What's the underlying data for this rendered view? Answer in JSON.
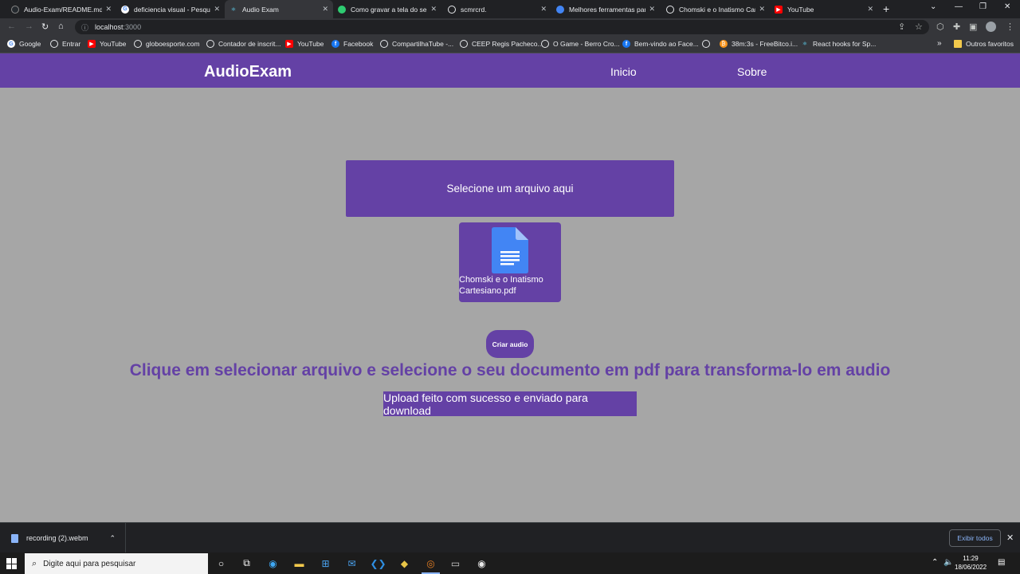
{
  "browser": {
    "tabs": [
      {
        "title": "Audio-Exam/README.md",
        "icon": "github-icon",
        "color": "#24292e"
      },
      {
        "title": "deficiencia visual - Pesquis",
        "icon": "google-icon",
        "color": "#ffffff"
      },
      {
        "title": "Audio Exam",
        "icon": "react-icon",
        "color": "#61dafb"
      },
      {
        "title": "Como gravar a tela do seu",
        "icon": "green-circle-icon",
        "color": "#2ecc71"
      },
      {
        "title": "scmrcrd.",
        "icon": "globe-icon",
        "color": "#e8eaed"
      },
      {
        "title": "Melhores ferramentas par",
        "icon": "blue-tool-icon",
        "color": "#4285f4"
      },
      {
        "title": "Chomski e o Inatismo Cart",
        "icon": "globe-icon",
        "color": "#e8eaed"
      },
      {
        "title": "YouTube",
        "icon": "youtube-icon",
        "color": "#ff0000"
      }
    ],
    "url": "localhost",
    "url_port": ":3000",
    "bookmarks": [
      {
        "label": "Google",
        "icon": "google-icon",
        "color": "#ffffff"
      },
      {
        "label": "Entrar",
        "icon": "globe-icon",
        "color": "#e8eaed"
      },
      {
        "label": "YouTube",
        "icon": "youtube-icon",
        "color": "#ff0000"
      },
      {
        "label": "globoesporte.com",
        "icon": "globe-icon",
        "color": "#e8eaed"
      },
      {
        "label": "Contador de inscrit...",
        "icon": "globe-icon",
        "color": "#e8eaed"
      },
      {
        "label": "YouTube",
        "icon": "youtube-icon",
        "color": "#ff0000"
      },
      {
        "label": "Facebook",
        "icon": "facebook-icon",
        "color": "#1877f2"
      },
      {
        "label": "CompartilhaTube -...",
        "icon": "globe-icon",
        "color": "#e8eaed"
      },
      {
        "label": "CEEP Regis Pacheco...",
        "icon": "globe-icon",
        "color": "#e8eaed"
      },
      {
        "label": "O Game - Berro Cro...",
        "icon": "globe-icon",
        "color": "#e8eaed"
      },
      {
        "label": "Bem-vindo ao Face...",
        "icon": "facebook-icon",
        "color": "#1877f2"
      },
      {
        "label": "",
        "icon": "globe-icon",
        "color": "#e8eaed"
      },
      {
        "label": "38m:3s - FreeBitco.i...",
        "icon": "bitcoin-icon",
        "color": "#f7931a"
      },
      {
        "label": "React hooks for Sp...",
        "icon": "react-icon",
        "color": "#61dafb"
      }
    ],
    "other_bookmarks": "Outros favoritos"
  },
  "app": {
    "brand": "AudioExam",
    "nav": [
      "Inicio",
      "Sobre"
    ],
    "select_file_label": "Selecione um arquivo aqui",
    "file_name": "Chomski e o Inatismo Cartesiano.pdf",
    "create_audio_label": "Criar audio",
    "instruction": "Clique em selecionar arquivo e selecione o seu documento em pdf para transforma-lo em audio",
    "success_message": "Upload feito com sucesso e enviado para download",
    "accent_color": "#6441a5"
  },
  "downloads": {
    "file": "recording (2).webm",
    "show_all": "Exibir todos"
  },
  "taskbar": {
    "search_placeholder": "Digite aqui para pesquisar",
    "time": "11:29",
    "date": "18/06/2022"
  }
}
